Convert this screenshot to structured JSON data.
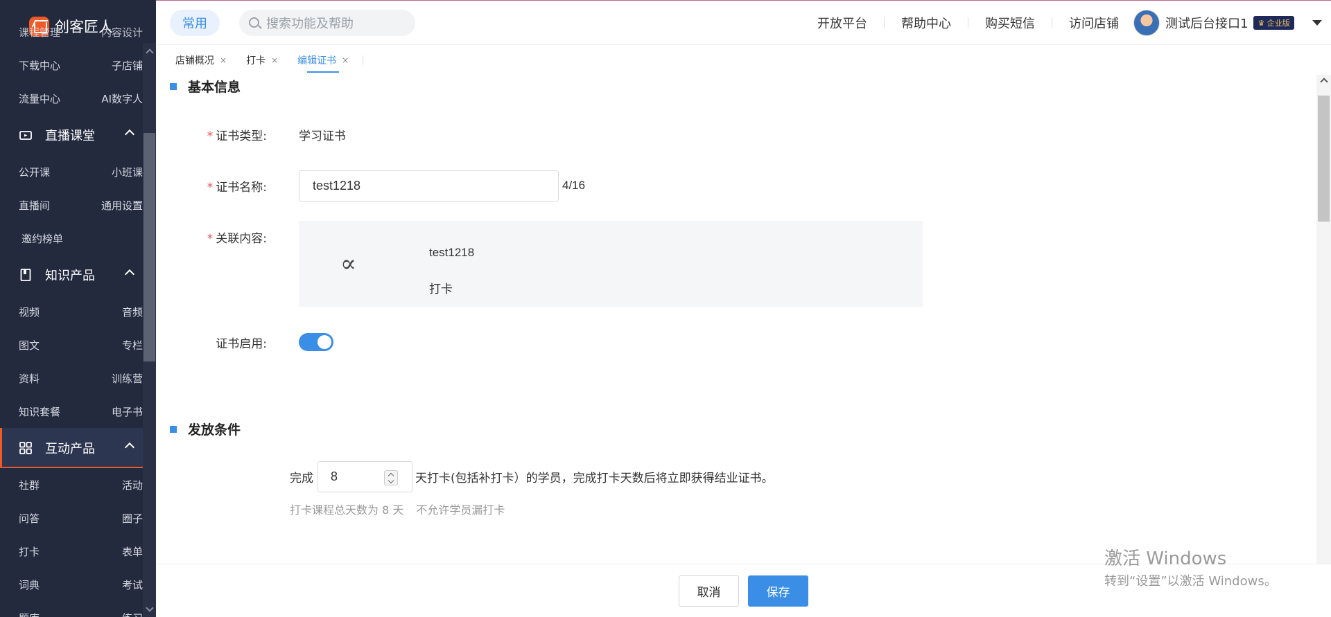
{
  "app": {
    "logo_text": "创客匠人"
  },
  "sidebar": {
    "clipped_row": [
      "课程管理",
      "内容设计"
    ],
    "rows_top": [
      [
        "下载中心",
        "子店铺"
      ],
      [
        "流量中心",
        "AI数字人"
      ]
    ],
    "groups": [
      {
        "label": "直播课堂",
        "icon": "live-icon",
        "rows": [
          [
            "公开课",
            "小班课"
          ],
          [
            "直播间",
            "通用设置"
          ],
          [
            "邀约榜单",
            ""
          ]
        ]
      },
      {
        "label": "知识产品",
        "icon": "book-icon",
        "rows": [
          [
            "视频",
            "音频"
          ],
          [
            "图文",
            "专栏"
          ],
          [
            "资料",
            "训练营"
          ],
          [
            "知识套餐",
            "电子书"
          ]
        ]
      },
      {
        "label": "互动产品",
        "icon": "grid-icon",
        "active": true,
        "rows": [
          [
            "社群",
            "活动"
          ],
          [
            "问答",
            "圈子"
          ],
          [
            "打卡",
            "表单"
          ],
          [
            "词典",
            "考试"
          ],
          [
            "题库",
            "练习"
          ]
        ]
      }
    ]
  },
  "header": {
    "pill": "常用",
    "search_placeholder": "搜索功能及帮助",
    "links": [
      "开放平台",
      "帮助中心",
      "购买短信",
      "访问店铺"
    ],
    "user_name": "测试后台接口1",
    "badge": "♛ 企业版"
  },
  "tabs": [
    {
      "label": "店铺概况",
      "close": "×"
    },
    {
      "label": "打卡",
      "close": "×"
    },
    {
      "label": "编辑证书",
      "close": "×",
      "active": true
    }
  ],
  "basic": {
    "title": "基本信息",
    "type_label": "证书类型:",
    "type_value": "学习证书",
    "name_label": "证书名称:",
    "name_value": "test1218",
    "name_counter": "4/16",
    "linked_label": "关联内容:",
    "linked_icon": "∝",
    "linked_title": "test1218",
    "linked_type": "打卡",
    "enable_label": "证书启用:",
    "enabled": true
  },
  "condition": {
    "title": "发放条件",
    "prefix": "完成",
    "days": "8",
    "suffix": "天打卡(包括补打卡）的学员，完成打卡天数后将立即获得结业证书。",
    "hint1": "打卡课程总天数为 8 天",
    "hint2": "不允许学员漏打卡"
  },
  "footer": {
    "cancel": "取消",
    "save": "保存"
  },
  "watermark": {
    "line1": "激活 Windows",
    "line2": "转到“设置”以激活 Windows。"
  },
  "colors": {
    "sidebar_bg": "#232a3e",
    "accent": "#3a8ee6",
    "brand": "#f05a28"
  }
}
